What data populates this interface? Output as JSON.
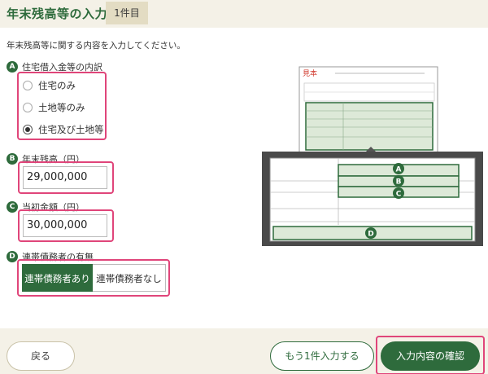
{
  "header": {
    "title": "年末残高等の入力",
    "count": "1件目"
  },
  "intro": "年末残高等に関する内容を入力してください。",
  "sections": {
    "a": {
      "badge": "A",
      "label": "住宅借入金等の内訳",
      "options": [
        {
          "label": "住宅のみ",
          "selected": false
        },
        {
          "label": "土地等のみ",
          "selected": false
        },
        {
          "label": "住宅及び土地等",
          "selected": true
        }
      ]
    },
    "b": {
      "badge": "B",
      "label": "年末残高（円）",
      "value": "29,000,000"
    },
    "c": {
      "badge": "C",
      "label": "当初金額（円）",
      "value": "30,000,000"
    },
    "d": {
      "badge": "D",
      "label": "連帯債務者の有無",
      "options": [
        {
          "label": "連帯債務者あり",
          "selected": true
        },
        {
          "label": "連帯債務者なし",
          "selected": false
        }
      ]
    }
  },
  "sample": {
    "stamp": "見本",
    "markers": [
      "A",
      "B",
      "C",
      "D"
    ]
  },
  "footer": {
    "back": "戻る",
    "add_more": "もう1件入力する",
    "confirm": "入力内容の確認"
  },
  "colors": {
    "accent": "#2e6b3c",
    "highlight": "#e0457a",
    "band": "#f4f1e7"
  }
}
